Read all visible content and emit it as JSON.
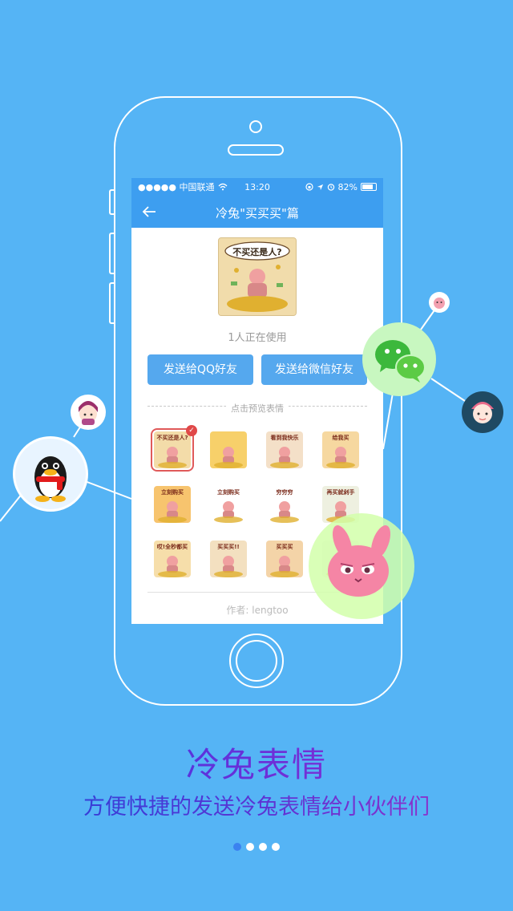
{
  "status_bar": {
    "carrier": "●●●●● 中国联通",
    "time": "13:20",
    "battery": "82%"
  },
  "nav": {
    "title": "冷兔\"买买买\"篇"
  },
  "cover": {
    "caption": "不买还是人?"
  },
  "usage_text": "1人正在使用",
  "buttons": {
    "send_qq": "发送给QQ好友",
    "send_wechat": "发送给微信好友"
  },
  "preview_label": "点击预览表情",
  "stickers": [
    {
      "caption": "不买还是人?",
      "bg": "#f3dca9"
    },
    {
      "caption": "",
      "bg": "#f7d06a"
    },
    {
      "caption": "看到我快乐",
      "bg": "#f4e0c8"
    },
    {
      "caption": "给我买",
      "bg": "#f6d8a0"
    },
    {
      "caption": "立刻购买",
      "bg": "#f7c46e"
    },
    {
      "caption": "立刻购买",
      "bg": "#ffffff"
    },
    {
      "caption": "穷穷穷",
      "bg": "#ffffff"
    },
    {
      "caption": "再买就剁手",
      "bg": "#eef0e0"
    },
    {
      "caption": "哎!全秒都买",
      "bg": "#f6deaa"
    },
    {
      "caption": "买买买!!",
      "bg": "#f3e0c0"
    },
    {
      "caption": "买买买",
      "bg": "#f4d4a8"
    },
    {
      "caption": "",
      "bg": "#f0f0f0"
    }
  ],
  "author_text": "作者: lengtoo",
  "headline": "冷兔表情",
  "subline": "方便快捷的发送冷兔表情给小伙伴们",
  "pagination": {
    "count": 4,
    "active": 0
  },
  "colors": {
    "background": "#55b4f5",
    "nav": "#3d9ef0",
    "button": "#55a8ee",
    "selected": "#e04848"
  }
}
